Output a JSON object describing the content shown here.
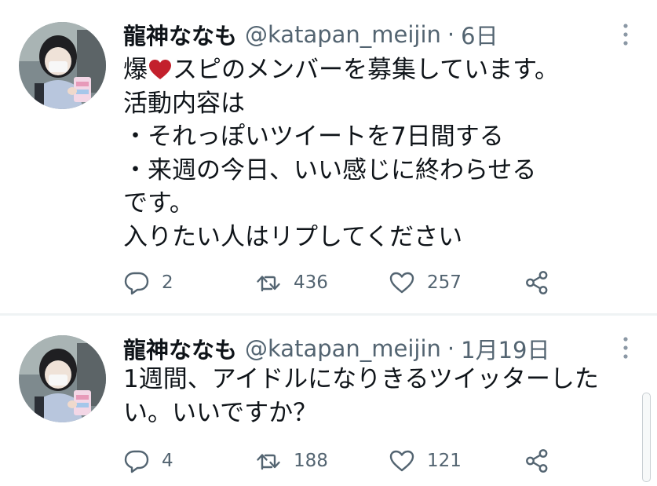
{
  "tweets": [
    {
      "author": {
        "display_name": "龍神ななも",
        "handle": "@katapan_meijin",
        "separator": "·",
        "time": "6日"
      },
      "body": {
        "line1_before_heart": "爆",
        "line1_after_heart": "スピのメンバーを募集しています。",
        "line2": "活動内容は",
        "line3": "・それっぽいツイートを7日間する",
        "line4": "・来週の今日、いい感じに終わらせる",
        "line5": "です。",
        "line6": "入りたい人はリプしてください"
      },
      "stats": {
        "replies": "2",
        "retweets": "436",
        "likes": "257"
      },
      "icons": [
        "heart-emoji",
        "reply-icon",
        "retweet-icon",
        "like-icon",
        "share-icon",
        "more-icon"
      ],
      "heart_color": "#c3202c"
    },
    {
      "author": {
        "display_name": "龍神ななも",
        "handle": "@katapan_meijin",
        "separator": "·",
        "time": "1月19日"
      },
      "body": {
        "line1": "1週間、アイドルになりきるツイッターした",
        "line2": "い。いいですか？"
      },
      "stats": {
        "replies": "4",
        "retweets": "188",
        "likes": "121"
      },
      "icons": [
        "reply-icon",
        "retweet-icon",
        "like-icon",
        "share-icon",
        "more-icon"
      ]
    }
  ],
  "colors": {
    "text_primary": "#0f1419",
    "text_secondary": "#536471",
    "separator": "#eff3f4"
  }
}
